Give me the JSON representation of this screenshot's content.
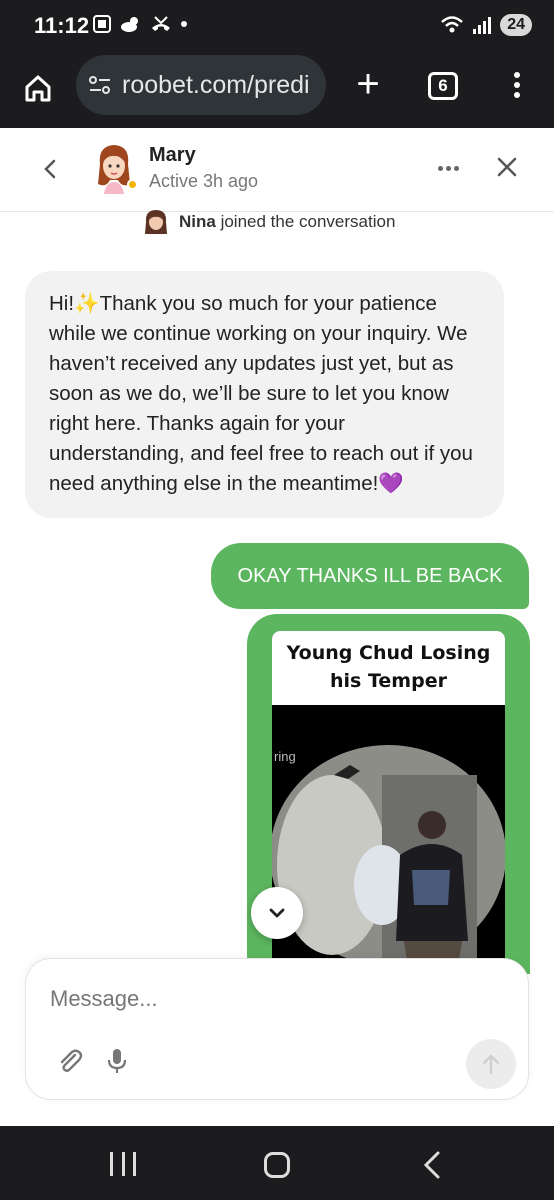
{
  "status_bar": {
    "time": "11:12",
    "battery": "24"
  },
  "browser": {
    "url": "roobet.com/predi",
    "tab_count": "6"
  },
  "chat_header": {
    "agent_name": "Mary",
    "agent_status": "Active 3h ago"
  },
  "messages": {
    "system": {
      "name": "Nina",
      "text": " joined the conversation"
    },
    "agent_message": {
      "part1": "Hi!",
      "sparkle": "✨",
      "part2": "Thank you so much for your patience while we continue working on your inquiry. We haven’t received any updates just yet, but as soon as we do, we’ll be sure to let you know right here. Thanks again for your understanding, and feel free to reach out if you need anything else in the meantime!",
      "heart": "💜"
    },
    "user_message": "OKAY THANKS ILL BE BACK",
    "image_message": {
      "caption": "Young Chud Losing his Temper",
      "watermark": "ring"
    }
  },
  "composer": {
    "placeholder": "Message..."
  },
  "colors": {
    "user_bubble": "#5cb65f",
    "agent_bubble": "#f2f2f2",
    "status_dot": "#f4b400",
    "system_bar": "#1c1c1e"
  }
}
